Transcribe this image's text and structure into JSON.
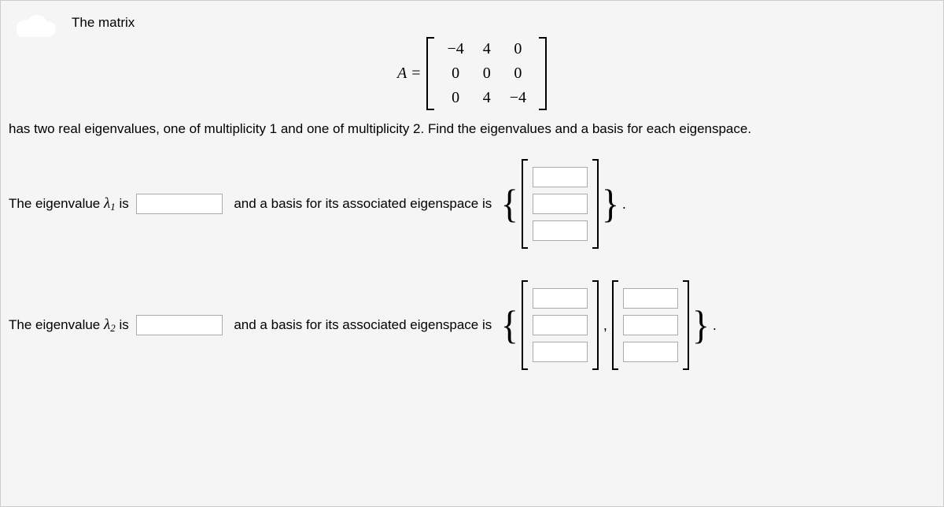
{
  "intro": {
    "line1": "The matrix",
    "equation_lhs": "A",
    "equals": "=",
    "matrix": [
      [
        "−4",
        "4",
        "0"
      ],
      [
        "0",
        "0",
        "0"
      ],
      [
        "0",
        "4",
        "−4"
      ]
    ],
    "line2": "has two real eigenvalues, one of multiplicity 1 and one of multiplicity 2. Find the eigenvalues and a basis for each eigenspace."
  },
  "row1": {
    "label_pre": "The eigenvalue ",
    "lambda": "λ",
    "sub": "1",
    "label_post": " is",
    "mid": "and a basis for its associated eigenspace is",
    "period": "."
  },
  "row2": {
    "label_pre": "The eigenvalue ",
    "lambda": "λ",
    "sub": "2",
    "label_post": " is",
    "mid": "and a basis for its associated eigenspace is",
    "comma": ",",
    "period": "."
  }
}
